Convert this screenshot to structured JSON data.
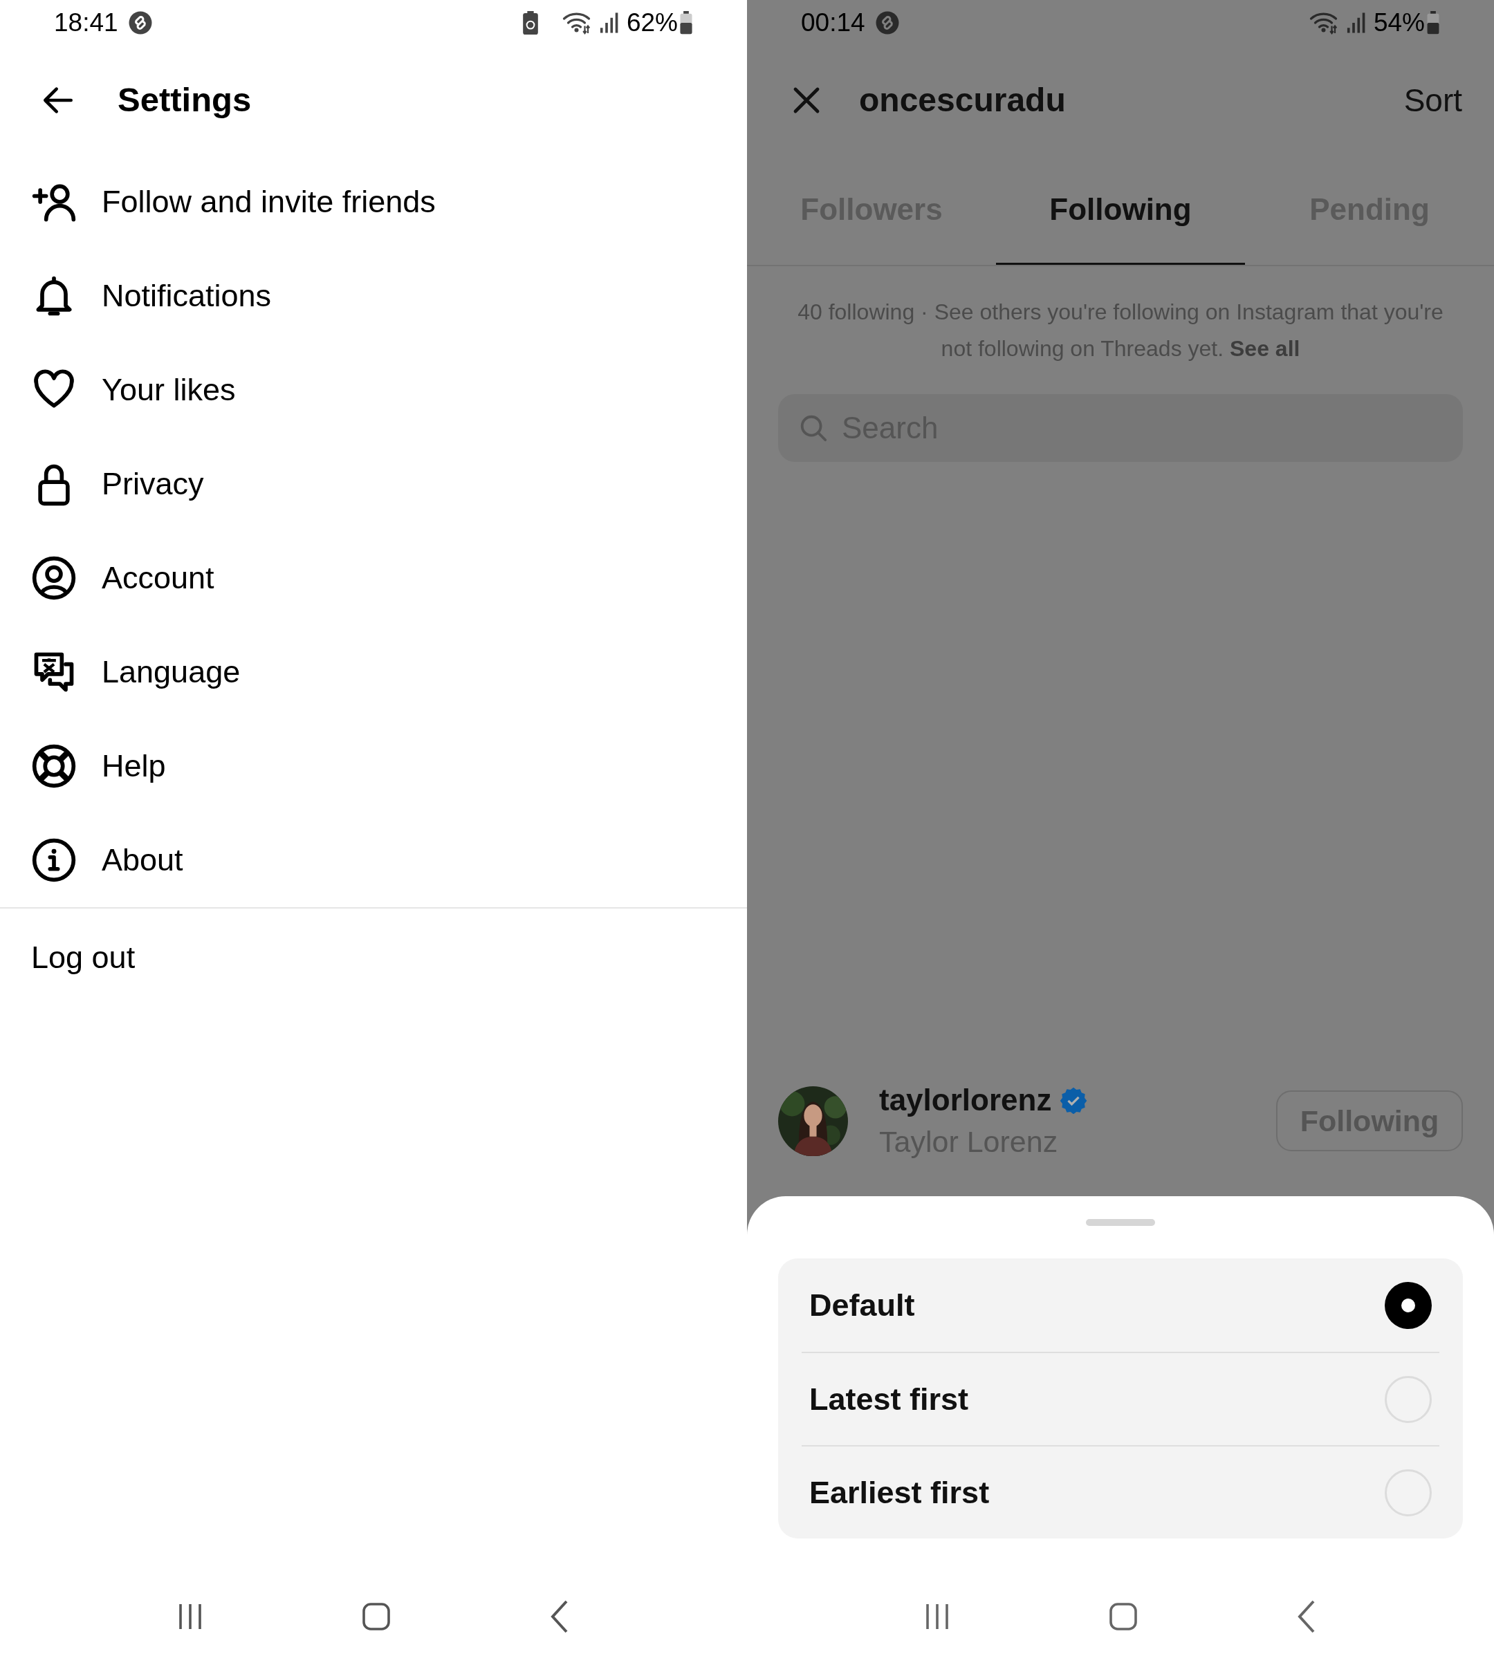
{
  "left_screen": {
    "status_bar": {
      "time": "18:41",
      "battery": "62%"
    },
    "header": {
      "title": "Settings"
    },
    "menu_items": [
      {
        "label": "Follow and invite friends"
      },
      {
        "label": "Notifications"
      },
      {
        "label": "Your likes"
      },
      {
        "label": "Privacy"
      },
      {
        "label": "Account"
      },
      {
        "label": "Language"
      },
      {
        "label": "Help"
      },
      {
        "label": "About"
      }
    ],
    "log_out": "Log out"
  },
  "right_screen": {
    "status_bar": {
      "time": "00:14",
      "battery": "54%"
    },
    "header": {
      "title": "oncescuradu",
      "action": "Sort"
    },
    "tabs": [
      {
        "label": "Followers",
        "selected": false
      },
      {
        "label": "Following",
        "selected": true
      },
      {
        "label": "Pending",
        "selected": false
      }
    ],
    "info": {
      "text": "40 following · See others you're following on Instagram that you're not following on Threads yet.",
      "link": "See all"
    },
    "search": {
      "placeholder": "Search"
    },
    "user": {
      "username": "taylorlorenz",
      "verified": true,
      "full_name": "Taylor Lorenz",
      "button": "Following"
    },
    "sort_options": [
      {
        "label": "Default",
        "selected": true
      },
      {
        "label": "Latest first",
        "selected": false
      },
      {
        "label": "Earliest first",
        "selected": false
      }
    ]
  }
}
